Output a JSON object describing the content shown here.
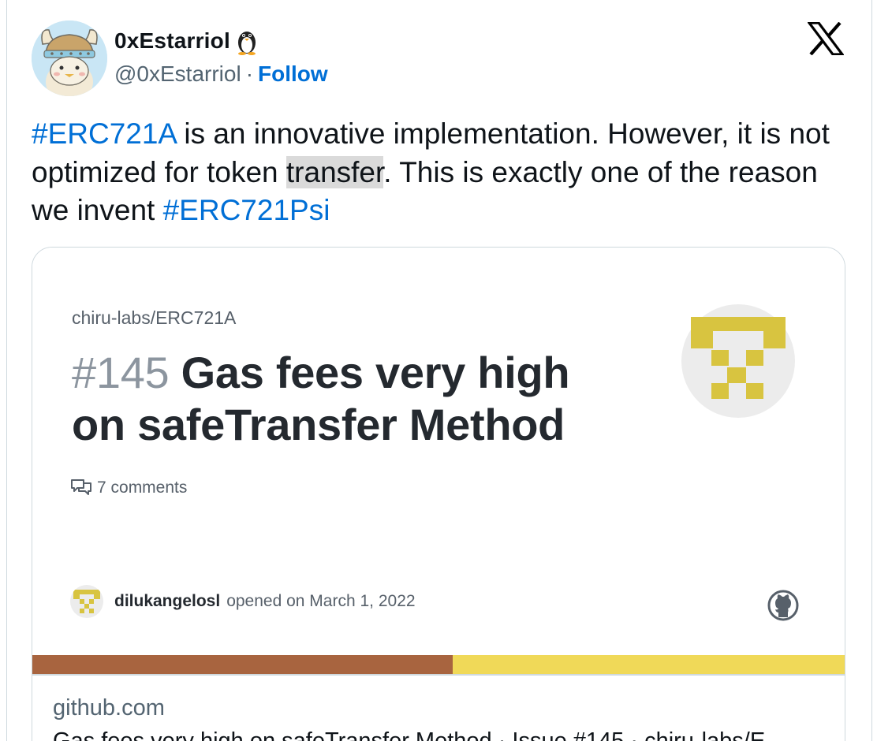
{
  "author": {
    "display_name": "0xEstarriol",
    "emoji_icon": "penguin-icon",
    "handle": "@0xEstarriol",
    "separator": "·",
    "follow_label": "Follow"
  },
  "platform_icon": "x-logo-icon",
  "tweet": {
    "hashtag1": "#ERC721A",
    "text1": " is an innovative implementation. However, it is not optimized for token ",
    "highlight": "transfer",
    "text2": ". This is exactly one of the reason we invent ",
    "hashtag2": "#ERC721Psi"
  },
  "link_card": {
    "repo": "chiru-labs/ERC721A",
    "issue_number": "#145",
    "issue_title": "Gas fees very high on safeTransfer Method",
    "comments": "7 comments",
    "author": "dilukangelosl",
    "opened_text": "opened on March 1, 2022",
    "domain": "github.com",
    "description": "Gas fees very high on safeTransfer Method · Issue #145 · chiru-labs/E",
    "colors": {
      "bar_left": "#a8643f",
      "bar_right": "#f0d958",
      "logo": "#d8c440"
    }
  },
  "colors": {
    "link": "#006fd6",
    "text": "#0f1419",
    "muted": "#536471"
  }
}
